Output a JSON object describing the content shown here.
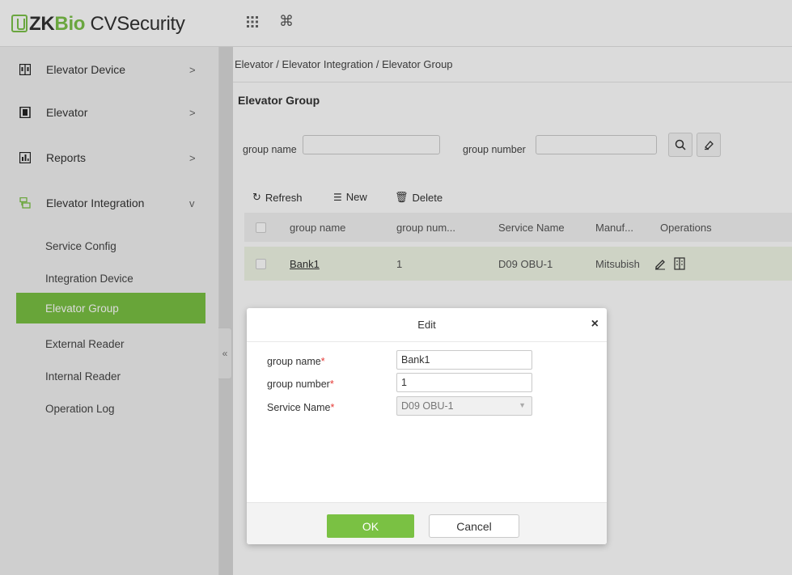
{
  "app": {
    "logo_prefix": "ZK",
    "logo_bio": "Bio",
    "logo_suffix": " CVSecurity",
    "top_icons": [
      "grid-icon",
      "command-icon"
    ]
  },
  "sidebar": {
    "menu": [
      {
        "label": "Elevator Device",
        "icon": "elevator-device-icon",
        "arrow": ">"
      },
      {
        "label": "Elevator",
        "icon": "elevator-icon",
        "arrow": ">"
      },
      {
        "label": "Reports",
        "icon": "reports-icon",
        "arrow": ">"
      },
      {
        "label": "Elevator Integration",
        "icon": "integration-icon",
        "arrow": "v"
      }
    ],
    "submenu": [
      {
        "label": "Service Config"
      },
      {
        "label": "Integration Device"
      },
      {
        "label": "Elevator Group",
        "active": true
      },
      {
        "label": "External Reader"
      },
      {
        "label": "Internal Reader"
      },
      {
        "label": "Operation Log"
      }
    ],
    "collapse_glyph": "«"
  },
  "main": {
    "breadcrumb": "Elevator / Elevator Integration / Elevator Group",
    "title": "Elevator Group",
    "filters": {
      "group_name_label": "group name",
      "group_number_label": "group number",
      "group_name_value": "",
      "group_number_value": ""
    },
    "toolbar": {
      "refresh": "Refresh",
      "new": "New",
      "delete": "Delete"
    },
    "table": {
      "columns": [
        "group name",
        "group num...",
        "Service Name",
        "Manuf...",
        "Operations"
      ],
      "rows": [
        {
          "group_name": "Bank1",
          "group_number": "1",
          "service_name": "D09 OBU-1",
          "manufacturer": "Mitsubish"
        }
      ]
    }
  },
  "modal": {
    "title": "Edit",
    "close": "×",
    "fields": {
      "group_name_label": "group name",
      "group_name_value": "Bank1",
      "group_number_label": "group number",
      "group_number_value": "1",
      "service_name_label": "Service Name",
      "service_name_value": "D09 OBU-1"
    },
    "required_mark": "*",
    "ok": "OK",
    "cancel": "Cancel"
  },
  "colors": {
    "accent": "#7ac143",
    "required": "#e53935"
  }
}
